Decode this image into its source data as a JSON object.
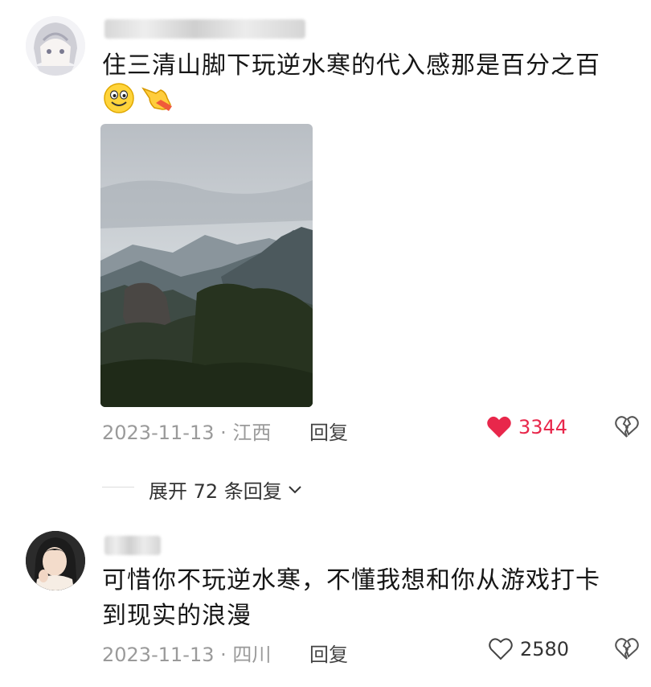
{
  "comments": [
    {
      "text": "住三清山脚下玩逆水寒的代入感那是百分之百",
      "emojis": [
        "smile-face-icon",
        "pointing-hand-icon"
      ],
      "date_location": "2023-11-13 · 江西",
      "reply_label": "回复",
      "like_count": "3344",
      "liked": true
    },
    {
      "text": "可惜你不玩逆水寒，不懂我想和你从游戏打卡到现实的浪漫",
      "date_location": "2023-11-13 · 四川",
      "reply_label": "回复",
      "like_count": "2580",
      "liked": false
    }
  ],
  "expand_replies_label": "展开 72 条回复",
  "colors": {
    "like_active": "#e8274b",
    "meta_gray": "#9a9a9a"
  }
}
